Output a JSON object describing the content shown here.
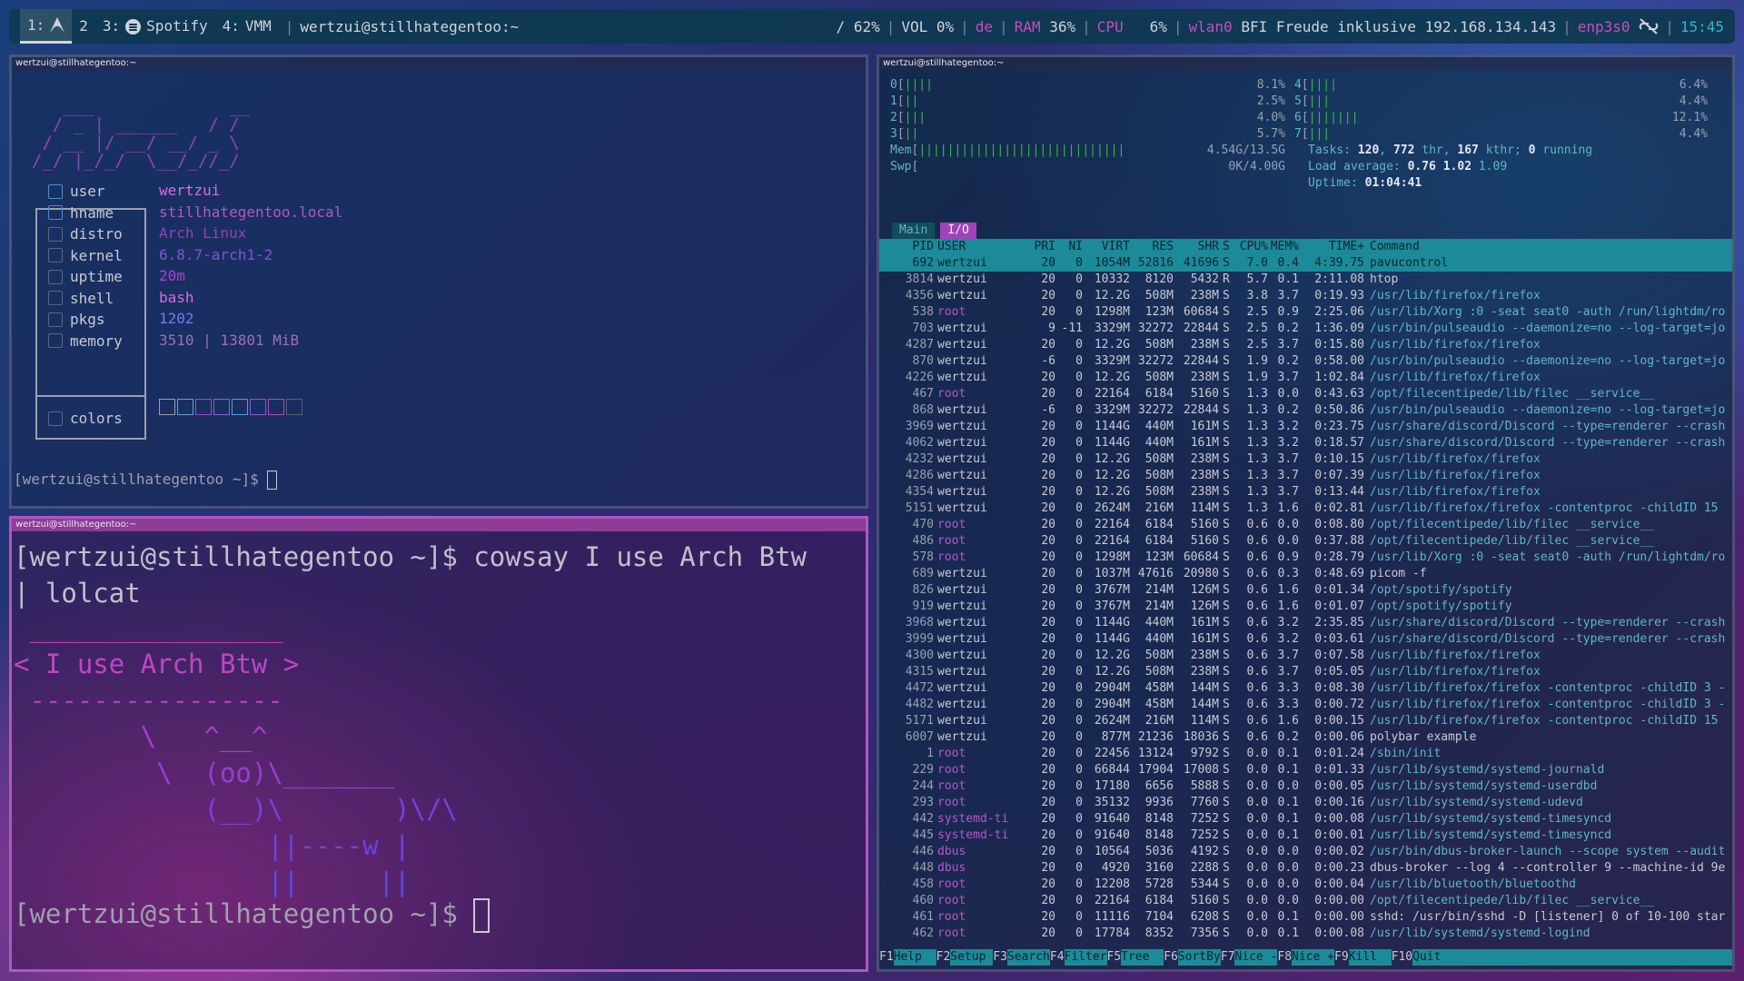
{
  "bar": {
    "workspaces": [
      {
        "num": "1:",
        "label": ""
      },
      {
        "num": "2",
        "label": ""
      },
      {
        "num": "3:",
        "label": "Spotify"
      },
      {
        "num": "4:",
        "label": "VMM"
      }
    ],
    "window_title": "wertzui@stillhategentoo:~",
    "disk": "/ 62%",
    "volume": "VOL 0%",
    "keyboard": "de",
    "ram_label": "RAM",
    "ram_value": "36%",
    "cpu_label": "CPU",
    "cpu_value": "6%",
    "wlan_label": "wlan0",
    "wlan_info": "BFI Freude inklusive 192.168.134.143",
    "eth_label": "enp3s0",
    "clock": "15:45",
    "accent": "#c64fbf"
  },
  "fetch_window": {
    "title": "wertzui@stillhategentoo:~",
    "ascii_logo": "   ___             __\n  / _ | ______   / /\n / __ |/ __/ __/ _ \\\n/_/ |_/_/  \\__/_//_/",
    "rows": [
      {
        "icon": "user-icon",
        "key": "user",
        "value": "wertzui",
        "color": "#d36fe0"
      },
      {
        "icon": "host-icon",
        "key": "hname",
        "value": "stillhategentoo.local",
        "color": "#b357c4"
      },
      {
        "icon": "distro-icon",
        "key": "distro",
        "value": "Arch Linux",
        "color": "#8f44b9"
      },
      {
        "icon": "kernel-icon",
        "key": "kernel",
        "value": "6.8.7-arch1-2",
        "color": "#7f55d9"
      },
      {
        "icon": "clock-icon",
        "key": "uptime",
        "value": "20m",
        "color": "#b23fd1"
      },
      {
        "icon": "shell-icon",
        "key": "shell",
        "value": "bash",
        "color": "#d36fe0"
      },
      {
        "icon": "package-icon",
        "key": "pkgs",
        "value": "1202",
        "color": "#6d7ef0"
      },
      {
        "icon": "memory-icon",
        "key": "memory",
        "value": "3510 | 13801 MiB",
        "color": "#9d6fb6"
      }
    ],
    "colors_label": "colors",
    "prompt": "[wertzui@stillhategentoo ~]$ "
  },
  "cowsay_window": {
    "title": "wertzui@stillhategentoo:~",
    "command": "[wertzui@stillhategentoo ~]$ cowsay I use Arch Btw\n| lolcat",
    "cow_lines": [
      " ________________",
      "< I use Arch Btw >",
      " ----------------",
      "        \\   ^__^",
      "         \\  (oo)\\_______",
      "            (__)\\       )\\/\\",
      "                ||----w |",
      "                ||     ||"
    ],
    "cow_colors": [
      "#c63aa8",
      "#c044c6",
      "#b13cc8",
      "#a13fd0",
      "#963ed5",
      "#7b3fdc",
      "#6a44e0",
      "#5a4ae6"
    ],
    "prompt": "[wertzui@stillhategentoo ~]$ "
  },
  "htop_window": {
    "title": "wertzui@stillhategentoo:~",
    "cpus": [
      {
        "id": "0",
        "bar": "||||",
        "pct": "8.1%"
      },
      {
        "id": "1",
        "bar": "||",
        "pct": "2.5%"
      },
      {
        "id": "2",
        "bar": "|||",
        "pct": "4.0%"
      },
      {
        "id": "3",
        "bar": "||",
        "pct": "5.7%"
      },
      {
        "id": "4",
        "bar": "||||",
        "pct": "6.4%"
      },
      {
        "id": "5",
        "bar": "|||",
        "pct": "4.4%"
      },
      {
        "id": "6",
        "bar": "|||||||",
        "pct": "12.1%"
      },
      {
        "id": "7",
        "bar": "|||",
        "pct": "4.4%"
      }
    ],
    "mem_label": "Mem",
    "mem_bar": "|||||||||||||||||||||||||||||",
    "mem_value": "4.54G/13.5G",
    "swp_label": "Swp",
    "swp_value": "0K/4.00G",
    "tasks_label": "Tasks:",
    "tasks": "120",
    "thr": "772",
    "kthr": "167",
    "running": "0",
    "load_label": "Load average:",
    "load1": "0.76",
    "load5": "1.02",
    "load15": "1.09",
    "uptime_label": "Uptime:",
    "uptime": "01:04:41",
    "tab_main": "Main",
    "tab_io": "I/O",
    "header": [
      "PID",
      "USER",
      "PRI",
      "NI",
      "VIRT",
      "RES",
      "SHR",
      "S",
      "CPU%",
      "MEM%",
      "TIME+",
      "Command"
    ],
    "processes": [
      [
        "692",
        "wertzui",
        "20",
        "0",
        "1054M",
        "52816",
        "41696",
        "S",
        "7.0",
        "0.4",
        "4:39.75",
        "pavucontrol"
      ],
      [
        "3814",
        "wertzui",
        "20",
        "0",
        "10332",
        "8120",
        "5432",
        "R",
        "5.7",
        "0.1",
        "2:11.08",
        "htop"
      ],
      [
        "4356",
        "wertzui",
        "20",
        "0",
        "12.2G",
        "508M",
        "238M",
        "S",
        "3.8",
        "3.7",
        "0:19.93",
        "/usr/lib/firefox/firefox"
      ],
      [
        "538",
        "root",
        "20",
        "0",
        "1298M",
        "123M",
        "60684",
        "S",
        "2.5",
        "0.9",
        "2:25.06",
        "/usr/lib/Xorg :0 -seat seat0 -auth /run/lightdm/ro"
      ],
      [
        "703",
        "wertzui",
        "9",
        "-11",
        "3329M",
        "32272",
        "22844",
        "S",
        "2.5",
        "0.2",
        "1:36.09",
        "/usr/bin/pulseaudio --daemonize=no --log-target=jo"
      ],
      [
        "4287",
        "wertzui",
        "20",
        "0",
        "12.2G",
        "508M",
        "238M",
        "S",
        "2.5",
        "3.7",
        "0:15.80",
        "/usr/lib/firefox/firefox"
      ],
      [
        "870",
        "wertzui",
        "-6",
        "0",
        "3329M",
        "32272",
        "22844",
        "S",
        "1.9",
        "0.2",
        "0:58.00",
        "/usr/bin/pulseaudio --daemonize=no --log-target=jo"
      ],
      [
        "4226",
        "wertzui",
        "20",
        "0",
        "12.2G",
        "508M",
        "238M",
        "S",
        "1.9",
        "3.7",
        "1:02.84",
        "/usr/lib/firefox/firefox"
      ],
      [
        "467",
        "root",
        "20",
        "0",
        "22164",
        "6184",
        "5160",
        "S",
        "1.3",
        "0.0",
        "0:43.63",
        "/opt/filecentipede/lib/filec __service__"
      ],
      [
        "868",
        "wertzui",
        "-6",
        "0",
        "3329M",
        "32272",
        "22844",
        "S",
        "1.3",
        "0.2",
        "0:50.86",
        "/usr/bin/pulseaudio --daemonize=no --log-target=jo"
      ],
      [
        "3969",
        "wertzui",
        "20",
        "0",
        "1144G",
        "440M",
        "161M",
        "S",
        "1.3",
        "3.2",
        "0:23.75",
        "/usr/share/discord/Discord --type=renderer --crash"
      ],
      [
        "4062",
        "wertzui",
        "20",
        "0",
        "1144G",
        "440M",
        "161M",
        "S",
        "1.3",
        "3.2",
        "0:18.57",
        "/usr/share/discord/Discord --type=renderer --crash"
      ],
      [
        "4232",
        "wertzui",
        "20",
        "0",
        "12.2G",
        "508M",
        "238M",
        "S",
        "1.3",
        "3.7",
        "0:10.15",
        "/usr/lib/firefox/firefox"
      ],
      [
        "4286",
        "wertzui",
        "20",
        "0",
        "12.2G",
        "508M",
        "238M",
        "S",
        "1.3",
        "3.7",
        "0:07.39",
        "/usr/lib/firefox/firefox"
      ],
      [
        "4354",
        "wertzui",
        "20",
        "0",
        "12.2G",
        "508M",
        "238M",
        "S",
        "1.3",
        "3.7",
        "0:13.44",
        "/usr/lib/firefox/firefox"
      ],
      [
        "5151",
        "wertzui",
        "20",
        "0",
        "2624M",
        "216M",
        "114M",
        "S",
        "1.3",
        "1.6",
        "0:02.81",
        "/usr/lib/firefox/firefox -contentproc -childID 15"
      ],
      [
        "470",
        "root",
        "20",
        "0",
        "22164",
        "6184",
        "5160",
        "S",
        "0.6",
        "0.0",
        "0:08.80",
        "/opt/filecentipede/lib/filec __service__"
      ],
      [
        "486",
        "root",
        "20",
        "0",
        "22164",
        "6184",
        "5160",
        "S",
        "0.6",
        "0.0",
        "0:37.88",
        "/opt/filecentipede/lib/filec __service__"
      ],
      [
        "578",
        "root",
        "20",
        "0",
        "1298M",
        "123M",
        "60684",
        "S",
        "0.6",
        "0.9",
        "0:28.79",
        "/usr/lib/Xorg :0 -seat seat0 -auth /run/lightdm/ro"
      ],
      [
        "689",
        "wertzui",
        "20",
        "0",
        "1037M",
        "47616",
        "20980",
        "S",
        "0.6",
        "0.3",
        "0:48.69",
        "picom -f"
      ],
      [
        "826",
        "wertzui",
        "20",
        "0",
        "3767M",
        "214M",
        "126M",
        "S",
        "0.6",
        "1.6",
        "0:01.34",
        "/opt/spotify/spotify"
      ],
      [
        "919",
        "wertzui",
        "20",
        "0",
        "3767M",
        "214M",
        "126M",
        "S",
        "0.6",
        "1.6",
        "0:01.07",
        "/opt/spotify/spotify"
      ],
      [
        "3968",
        "wertzui",
        "20",
        "0",
        "1144G",
        "440M",
        "161M",
        "S",
        "0.6",
        "3.2",
        "2:35.85",
        "/usr/share/discord/Discord --type=renderer --crash"
      ],
      [
        "3999",
        "wertzui",
        "20",
        "0",
        "1144G",
        "440M",
        "161M",
        "S",
        "0.6",
        "3.2",
        "0:03.61",
        "/usr/share/discord/Discord --type=renderer --crash"
      ],
      [
        "4300",
        "wertzui",
        "20",
        "0",
        "12.2G",
        "508M",
        "238M",
        "S",
        "0.6",
        "3.7",
        "0:07.58",
        "/usr/lib/firefox/firefox"
      ],
      [
        "4315",
        "wertzui",
        "20",
        "0",
        "12.2G",
        "508M",
        "238M",
        "S",
        "0.6",
        "3.7",
        "0:05.05",
        "/usr/lib/firefox/firefox"
      ],
      [
        "4472",
        "wertzui",
        "20",
        "0",
        "2904M",
        "458M",
        "144M",
        "S",
        "0.6",
        "3.3",
        "0:08.30",
        "/usr/lib/firefox/firefox -contentproc -childID 3 -"
      ],
      [
        "4482",
        "wertzui",
        "20",
        "0",
        "2904M",
        "458M",
        "144M",
        "S",
        "0.6",
        "3.3",
        "0:00.72",
        "/usr/lib/firefox/firefox -contentproc -childID 3 -"
      ],
      [
        "5171",
        "wertzui",
        "20",
        "0",
        "2624M",
        "216M",
        "114M",
        "S",
        "0.6",
        "1.6",
        "0:00.15",
        "/usr/lib/firefox/firefox -contentproc -childID 15"
      ],
      [
        "6007",
        "wertzui",
        "20",
        "0",
        "877M",
        "21236",
        "18036",
        "S",
        "0.6",
        "0.2",
        "0:00.06",
        "polybar example"
      ],
      [
        "1",
        "root",
        "20",
        "0",
        "22456",
        "13124",
        "9792",
        "S",
        "0.0",
        "0.1",
        "0:01.24",
        "/sbin/init"
      ],
      [
        "229",
        "root",
        "20",
        "0",
        "66844",
        "17904",
        "17008",
        "S",
        "0.0",
        "0.1",
        "0:01.33",
        "/usr/lib/systemd/systemd-journald"
      ],
      [
        "244",
        "root",
        "20",
        "0",
        "17180",
        "6656",
        "5888",
        "S",
        "0.0",
        "0.0",
        "0:00.05",
        "/usr/lib/systemd/systemd-userdbd"
      ],
      [
        "293",
        "root",
        "20",
        "0",
        "35132",
        "9936",
        "7760",
        "S",
        "0.0",
        "0.1",
        "0:00.16",
        "/usr/lib/systemd/systemd-udevd"
      ],
      [
        "442",
        "systemd-ti",
        "20",
        "0",
        "91640",
        "8148",
        "7252",
        "S",
        "0.0",
        "0.1",
        "0:00.08",
        "/usr/lib/systemd/systemd-timesyncd"
      ],
      [
        "445",
        "systemd-ti",
        "20",
        "0",
        "91640",
        "8148",
        "7252",
        "S",
        "0.0",
        "0.1",
        "0:00.01",
        "/usr/lib/systemd/systemd-timesyncd"
      ],
      [
        "446",
        "dbus",
        "20",
        "0",
        "10564",
        "5036",
        "4192",
        "S",
        "0.0",
        "0.0",
        "0:00.02",
        "/usr/bin/dbus-broker-launch --scope system --audit"
      ],
      [
        "448",
        "dbus",
        "20",
        "0",
        "4920",
        "3160",
        "2288",
        "S",
        "0.0",
        "0.0",
        "0:00.23",
        "dbus-broker --log 4 --controller 9 --machine-id 9e"
      ],
      [
        "458",
        "root",
        "20",
        "0",
        "12208",
        "5728",
        "5344",
        "S",
        "0.0",
        "0.0",
        "0:00.04",
        "/usr/lib/bluetooth/bluetoothd"
      ],
      [
        "460",
        "root",
        "20",
        "0",
        "22164",
        "6184",
        "5160",
        "S",
        "0.0",
        "0.0",
        "0:00.00",
        "/opt/filecentipede/lib/filec __service__"
      ],
      [
        "461",
        "root",
        "20",
        "0",
        "11116",
        "7104",
        "6208",
        "S",
        "0.0",
        "0.1",
        "0:00.00",
        "sshd: /usr/bin/sshd -D [listener] 0 of 10-100 star"
      ],
      [
        "462",
        "root",
        "20",
        "0",
        "17784",
        "8352",
        "7356",
        "S",
        "0.0",
        "0.1",
        "0:00.08",
        "/usr/lib/systemd/systemd-logind"
      ]
    ],
    "fkeys": [
      {
        "key": "F1",
        "label": "Help  "
      },
      {
        "key": "F2",
        "label": "Setup "
      },
      {
        "key": "F3",
        "label": "Search"
      },
      {
        "key": "F4",
        "label": "Filter"
      },
      {
        "key": "F5",
        "label": "Tree  "
      },
      {
        "key": "F6",
        "label": "SortBy"
      },
      {
        "key": "F7",
        "label": "Nice -"
      },
      {
        "key": "F8",
        "label": "Nice +"
      },
      {
        "key": "F9",
        "label": "Kill  "
      },
      {
        "key": "F10",
        "label": "Quit"
      }
    ]
  }
}
